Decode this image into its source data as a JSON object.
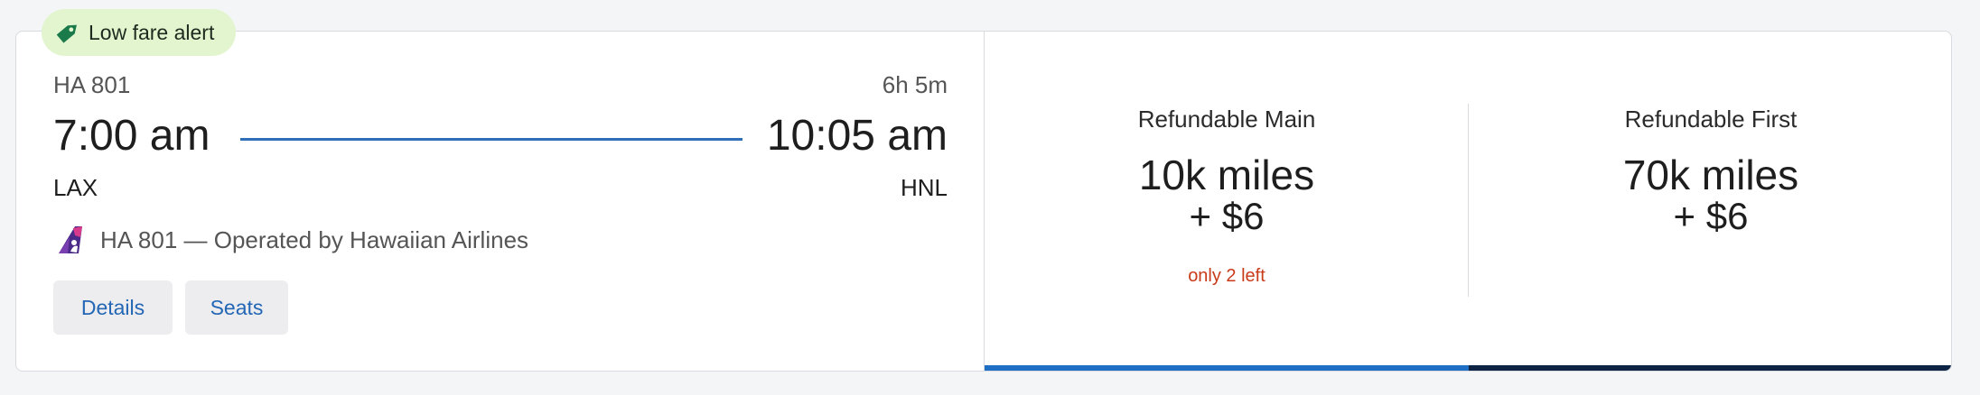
{
  "alert": {
    "label": "Low fare alert",
    "icon": "tag-icon",
    "color": "#e2f5cf",
    "icon_color": "#1a7a4a"
  },
  "flight": {
    "number": "HA 801",
    "duration": "6h 5m",
    "departure_time": "7:00 am",
    "arrival_time": "10:05 am",
    "departure_airport": "LAX",
    "arrival_airport": "HNL",
    "operator_text": "HA 801 — Operated by Hawaiian Airlines",
    "airline_logo": "hawaiian-airlines-logo",
    "route_color": "#2f6fb8"
  },
  "actions": {
    "details_label": "Details",
    "seats_label": "Seats",
    "link_color": "#2367b5"
  },
  "fares": [
    {
      "name": "Refundable Main",
      "miles": "10k miles",
      "cash": "+ $6",
      "note": "only 2 left",
      "bar_color": "#1f6fc4"
    },
    {
      "name": "Refundable First",
      "miles": "70k miles",
      "cash": "+ $6",
      "note": "",
      "bar_color": "#0c2344"
    }
  ]
}
